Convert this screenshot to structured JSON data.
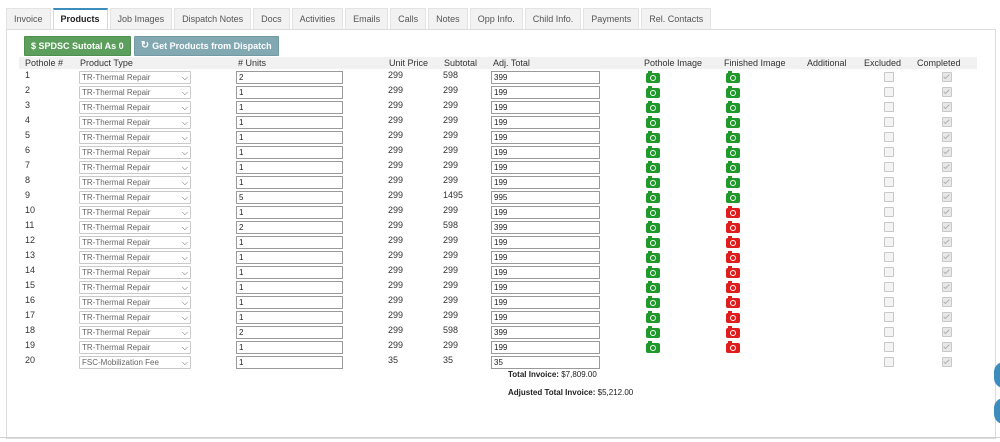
{
  "tabs": [
    {
      "label": "Invoice",
      "active": false
    },
    {
      "label": "Products",
      "active": true
    },
    {
      "label": "Job Images",
      "active": false
    },
    {
      "label": "Dispatch Notes",
      "active": false
    },
    {
      "label": "Docs",
      "active": false
    },
    {
      "label": "Activities",
      "active": false
    },
    {
      "label": "Emails",
      "active": false
    },
    {
      "label": "Calls",
      "active": false
    },
    {
      "label": "Notes",
      "active": false
    },
    {
      "label": "Opp Info.",
      "active": false
    },
    {
      "label": "Child Info.",
      "active": false
    },
    {
      "label": "Payments",
      "active": false
    },
    {
      "label": "Rel. Contacts",
      "active": false
    }
  ],
  "toolbar": {
    "subtotal_label": "$ SPDSC Sutotal As 0",
    "get_products_label": "Get Products from Dispatch",
    "subtotal_color": "#5c9f5c",
    "get_products_color": "#82a8b2"
  },
  "columns": {
    "pothole": "Pothole #",
    "product_type": "Product Type",
    "units": "# Units",
    "unit_price": "Unit Price",
    "subtotal": "Subtotal",
    "adj_total": "Adj. Total",
    "pothole_image": "Pothole Image",
    "finished_image": "Finished Image",
    "additional": "Additional",
    "excluded": "Excluded",
    "completed": "Completed"
  },
  "status_colors": {
    "image_present": "#1f9a2a",
    "image_missing": "#e01d1d"
  },
  "rows": [
    {
      "num": "1",
      "product": "TR-Thermal Repair",
      "units": "2",
      "unit_price": "299",
      "subtotal": "598",
      "adj_total": "399",
      "pothole_image": "camera-icon-green",
      "finished_image": "camera-icon-green",
      "excluded": false,
      "completed": true
    },
    {
      "num": "2",
      "product": "TR-Thermal Repair",
      "units": "1",
      "unit_price": "299",
      "subtotal": "299",
      "adj_total": "199",
      "pothole_image": "camera-icon-green",
      "finished_image": "camera-icon-green",
      "excluded": false,
      "completed": true
    },
    {
      "num": "3",
      "product": "TR-Thermal Repair",
      "units": "1",
      "unit_price": "299",
      "subtotal": "299",
      "adj_total": "199",
      "pothole_image": "camera-icon-green",
      "finished_image": "camera-icon-green",
      "excluded": false,
      "completed": true
    },
    {
      "num": "4",
      "product": "TR-Thermal Repair",
      "units": "1",
      "unit_price": "299",
      "subtotal": "299",
      "adj_total": "199",
      "pothole_image": "camera-icon-green",
      "finished_image": "camera-icon-green",
      "excluded": false,
      "completed": true
    },
    {
      "num": "5",
      "product": "TR-Thermal Repair",
      "units": "1",
      "unit_price": "299",
      "subtotal": "299",
      "adj_total": "199",
      "pothole_image": "camera-icon-green",
      "finished_image": "camera-icon-green",
      "excluded": false,
      "completed": true
    },
    {
      "num": "6",
      "product": "TR-Thermal Repair",
      "units": "1",
      "unit_price": "299",
      "subtotal": "299",
      "adj_total": "199",
      "pothole_image": "camera-icon-green",
      "finished_image": "camera-icon-green",
      "excluded": false,
      "completed": true
    },
    {
      "num": "7",
      "product": "TR-Thermal Repair",
      "units": "1",
      "unit_price": "299",
      "subtotal": "299",
      "adj_total": "199",
      "pothole_image": "camera-icon-green",
      "finished_image": "camera-icon-green",
      "excluded": false,
      "completed": true
    },
    {
      "num": "8",
      "product": "TR-Thermal Repair",
      "units": "1",
      "unit_price": "299",
      "subtotal": "299",
      "adj_total": "199",
      "pothole_image": "camera-icon-green",
      "finished_image": "camera-icon-green",
      "excluded": false,
      "completed": true
    },
    {
      "num": "9",
      "product": "TR-Thermal Repair",
      "units": "5",
      "unit_price": "299",
      "subtotal": "1495",
      "adj_total": "995",
      "pothole_image": "camera-icon-green",
      "finished_image": "camera-icon-green",
      "excluded": false,
      "completed": true
    },
    {
      "num": "10",
      "product": "TR-Thermal Repair",
      "units": "1",
      "unit_price": "299",
      "subtotal": "299",
      "adj_total": "199",
      "pothole_image": "camera-icon-green",
      "finished_image": "camera-icon-red",
      "excluded": false,
      "completed": true
    },
    {
      "num": "11",
      "product": "TR-Thermal Repair",
      "units": "2",
      "unit_price": "299",
      "subtotal": "598",
      "adj_total": "399",
      "pothole_image": "camera-icon-green",
      "finished_image": "camera-icon-red",
      "excluded": false,
      "completed": true
    },
    {
      "num": "12",
      "product": "TR-Thermal Repair",
      "units": "1",
      "unit_price": "299",
      "subtotal": "299",
      "adj_total": "199",
      "pothole_image": "camera-icon-green",
      "finished_image": "camera-icon-red",
      "excluded": false,
      "completed": true
    },
    {
      "num": "13",
      "product": "TR-Thermal Repair",
      "units": "1",
      "unit_price": "299",
      "subtotal": "299",
      "adj_total": "199",
      "pothole_image": "camera-icon-green",
      "finished_image": "camera-icon-red",
      "excluded": false,
      "completed": true
    },
    {
      "num": "14",
      "product": "TR-Thermal Repair",
      "units": "1",
      "unit_price": "299",
      "subtotal": "299",
      "adj_total": "199",
      "pothole_image": "camera-icon-green",
      "finished_image": "camera-icon-red",
      "excluded": false,
      "completed": true
    },
    {
      "num": "15",
      "product": "TR-Thermal Repair",
      "units": "1",
      "unit_price": "299",
      "subtotal": "299",
      "adj_total": "199",
      "pothole_image": "camera-icon-green",
      "finished_image": "camera-icon-red",
      "excluded": false,
      "completed": true
    },
    {
      "num": "16",
      "product": "TR-Thermal Repair",
      "units": "1",
      "unit_price": "299",
      "subtotal": "299",
      "adj_total": "199",
      "pothole_image": "camera-icon-green",
      "finished_image": "camera-icon-red",
      "excluded": false,
      "completed": true
    },
    {
      "num": "17",
      "product": "TR-Thermal Repair",
      "units": "1",
      "unit_price": "299",
      "subtotal": "299",
      "adj_total": "199",
      "pothole_image": "camera-icon-green",
      "finished_image": "camera-icon-red",
      "excluded": false,
      "completed": true
    },
    {
      "num": "18",
      "product": "TR-Thermal Repair",
      "units": "2",
      "unit_price": "299",
      "subtotal": "598",
      "adj_total": "399",
      "pothole_image": "camera-icon-green",
      "finished_image": "camera-icon-red",
      "excluded": false,
      "completed": true
    },
    {
      "num": "19",
      "product": "TR-Thermal Repair",
      "units": "1",
      "unit_price": "299",
      "subtotal": "299",
      "adj_total": "199",
      "pothole_image": "camera-icon-green",
      "finished_image": "camera-icon-red",
      "excluded": false,
      "completed": true
    },
    {
      "num": "20",
      "product": "FSC-Mobilization Fee",
      "units": "1",
      "unit_price": "35",
      "subtotal": "35",
      "adj_total": "35",
      "pothole_image": "",
      "finished_image": "",
      "excluded": false,
      "completed": true
    }
  ],
  "totals": {
    "total_label": "Total Invoice:",
    "total_value": "$7,809.00",
    "adjusted_label": "Adjusted Total Invoice:",
    "adjusted_value": "$5,212.00"
  }
}
